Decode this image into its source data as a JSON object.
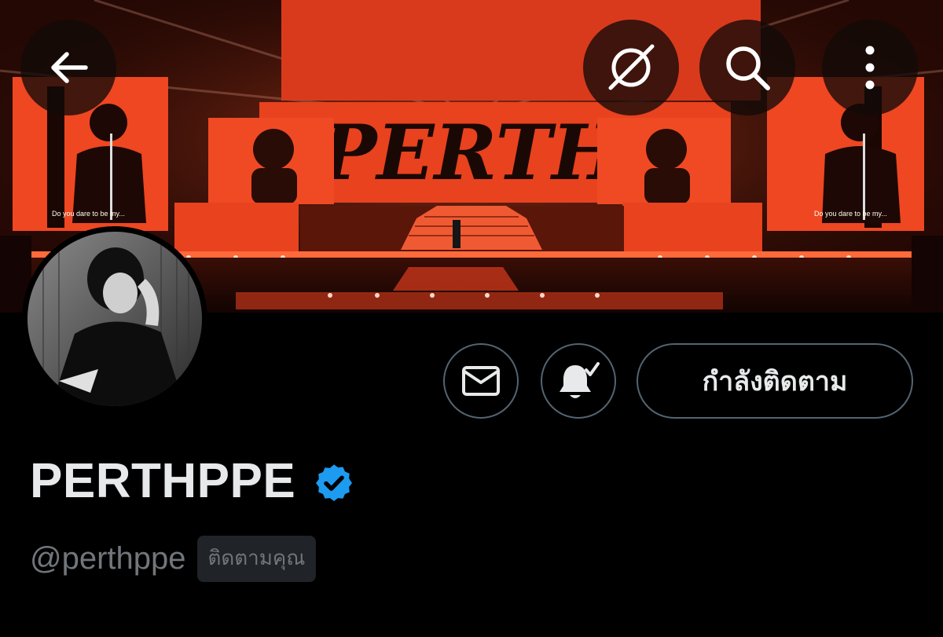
{
  "banner": {
    "screen_title": "PERTH",
    "screen_caption": "Do you dare to be my..."
  },
  "header": {
    "back_icon": "arrow-left-icon",
    "grok_icon": "grok-icon",
    "search_icon": "search-icon",
    "more_icon": "more-vertical-icon"
  },
  "actions": {
    "message_icon": "envelope-icon",
    "notify_icon": "bell-check-icon",
    "following_label": "กำลังติดตาม"
  },
  "profile": {
    "display_name": "PERTHPPE",
    "handle": "@perthppe",
    "follows_you_badge": "ติดตามคุณ",
    "verified_icon": "verified-badge-icon"
  },
  "colors": {
    "background": "#000000",
    "text_primary": "#e7e9ea",
    "text_secondary": "#71767b",
    "border": "#536471",
    "verified_blue": "#1d9bf0",
    "banner_red": "#e8421f"
  }
}
